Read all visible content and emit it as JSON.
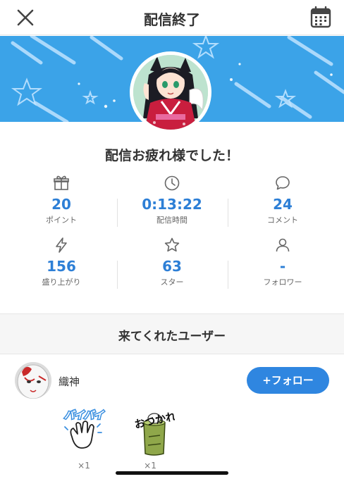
{
  "header": {
    "title": "配信終了",
    "close_icon": "close-icon",
    "calendar_icon": "calendar-icon"
  },
  "banner": {
    "background": "#3ba3e8"
  },
  "message": "配信お疲れ様でした！",
  "stats": [
    {
      "icon": "gift-icon",
      "value": "20",
      "label": "ポイント"
    },
    {
      "icon": "clock-icon",
      "value": "0:13:22",
      "label": "配信時間"
    },
    {
      "icon": "comment-icon",
      "value": "24",
      "label": "コメント"
    },
    {
      "icon": "lightning-icon",
      "value": "156",
      "label": "盛り上がり"
    },
    {
      "icon": "star-icon",
      "value": "63",
      "label": "スター"
    },
    {
      "icon": "person-icon",
      "value": "-",
      "label": "フォロワー"
    }
  ],
  "visitors": {
    "title": "来てくれたユーザー",
    "users": [
      {
        "name": "織神",
        "follow_label": "+フォロー",
        "gifts": [
          {
            "name": "バイバイ",
            "count": "×1"
          },
          {
            "name": "おつかれさま",
            "count": "×1"
          }
        ]
      }
    ]
  },
  "colors": {
    "accent": "#2f86e0",
    "stat_value": "#2d7fd6"
  }
}
